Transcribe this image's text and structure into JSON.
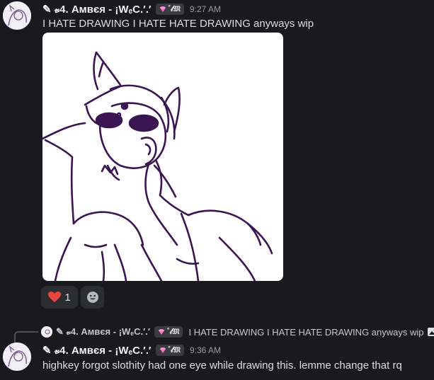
{
  "messages": [
    {
      "username": "✎ 𝓋4. Амвєя - ¡WₑC.′.′",
      "tag": "˚𝓁𝔐",
      "timestamp": "9:27 AM",
      "text": "I HATE DRAWING I HATE HATE DRAWING anyways wip",
      "attachment_icon": "drawing-image",
      "reactions": [
        {
          "emoji": "heart-icon",
          "count": "1"
        },
        {
          "emoji": "add-reaction-icon"
        }
      ]
    },
    {
      "reply": {
        "username": "✎ 𝓋4. Амвєя - ¡WₑC.′.′",
        "tag": "˚𝓁𝔐",
        "text": "I HATE DRAWING I HATE HATE DRAWING anyways wip",
        "icon": "image-icon"
      },
      "username": "✎ 𝓋4. Амвєя - ¡WₑC.′.′",
      "tag": "˚𝓁𝔐",
      "timestamp": "9:36 AM",
      "text": "highkey forgot slothity had one eye while drawing this. lemme change that rq"
    }
  ],
  "colors": {
    "background": "#1a1a1e",
    "text": "#dbdee1",
    "username": "#f2f3f5",
    "timestamp": "#949ba4",
    "reaction_bg": "#2b2d31",
    "heart": "#e8453c",
    "line_art": "#3b1452"
  }
}
